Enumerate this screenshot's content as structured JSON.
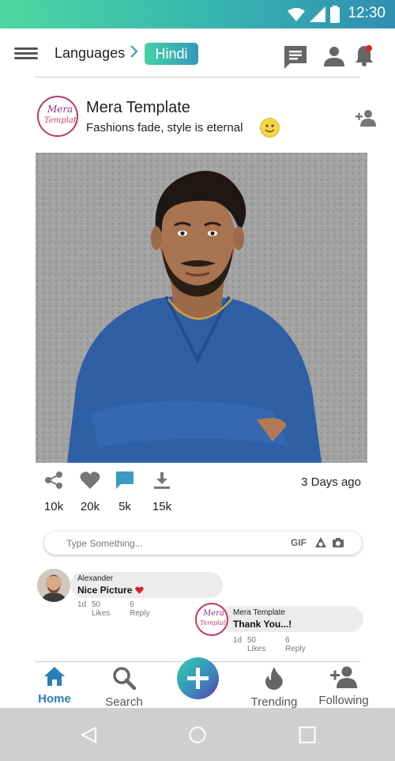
{
  "status_bar": {
    "time": "12:30"
  },
  "header": {
    "breadcrumb": "Languages",
    "current_language": "Hindi",
    "icons": [
      "menu-icon",
      "chevron-right-icon",
      "chat-icon",
      "profile-icon",
      "notification-bell-icon"
    ]
  },
  "post": {
    "author": "Mera Template",
    "tagline": "Fashions fade, style is eternal",
    "logo_line1": "Mera",
    "logo_line2": "Template",
    "posted_ago": "3 Days ago",
    "stats": {
      "shares": "10k",
      "likes": "20k",
      "comments": "5k",
      "downloads": "15k"
    }
  },
  "comment_input": {
    "placeholder": "Type Something...",
    "gif_label": "GIF"
  },
  "comments": [
    {
      "author": "Alexander",
      "text": "Nice Picture",
      "age": "1d",
      "likes": "50 Likes",
      "replies": "6 Reply"
    },
    {
      "author": "Mera Template",
      "text": "Thank You...!",
      "age": "1d",
      "likes": "50 Likes",
      "replies": "6 Reply"
    }
  ],
  "bottom_nav": {
    "items": [
      {
        "label": "Home",
        "icon": "home-icon",
        "active": true
      },
      {
        "label": "Search",
        "icon": "search-icon"
      },
      {
        "label": "Trending",
        "icon": "flame-icon"
      },
      {
        "label": "Following",
        "icon": "add-user-icon"
      }
    ]
  },
  "colors": {
    "accent": "#2a7fb8",
    "gradient_start": "#45d2a6",
    "gradient_end": "#3498b9",
    "notification_dot": "#e0202a"
  }
}
